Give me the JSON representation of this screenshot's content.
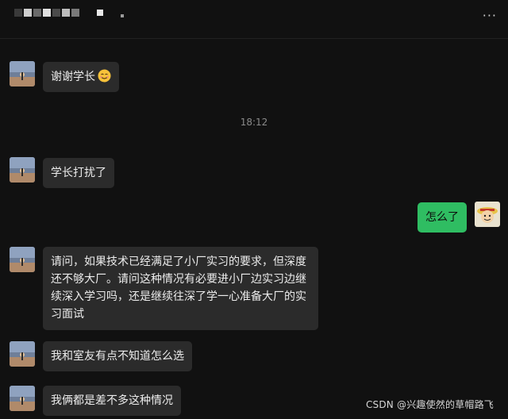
{
  "header": {
    "more_label": "···"
  },
  "timestamp": "18:12",
  "messages": [
    {
      "text": "谢谢学长",
      "emoji": "smiling-face-icon"
    },
    {
      "text": "学长打扰了"
    },
    {
      "text": "怎么了"
    },
    {
      "lines": [
        "请问，如果技术已经满足了小厂实习的要求，但深度",
        "还不够大厂。请问这种情况有必要进小厂边实习边继",
        "续深入学习吗，还是继续往深了学一心准备大厂的实",
        "习面试"
      ]
    },
    {
      "text": "我和室友有点不知道怎么选"
    },
    {
      "text": "我俩都是差不多这种情况"
    }
  ],
  "watermark": "CSDN @兴趣使然的草帽路飞",
  "colors": {
    "background": "#111111",
    "incoming_bubble": "#2b2b2b",
    "outgoing_bubble": "#2fbd62",
    "timestamp": "#8a8a8a"
  }
}
